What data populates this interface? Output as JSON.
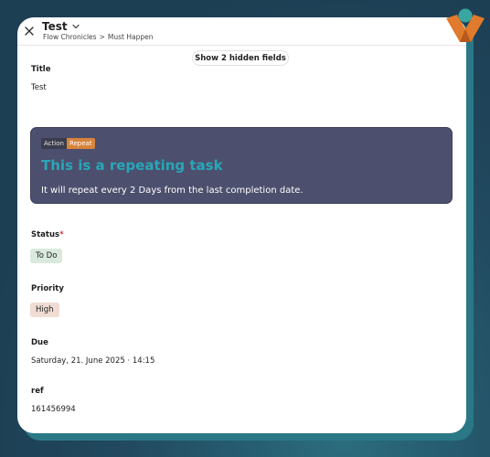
{
  "header": {
    "title": "Test",
    "breadcrumb": [
      "Flow Chronicles",
      "Must Happen"
    ],
    "breadcrumb_separator": ">"
  },
  "hidden_fields_button": "Show 2 hidden fields",
  "fields": {
    "title": {
      "label": "Title",
      "value": "Test"
    },
    "status": {
      "label": "Status",
      "required_marker": "*",
      "value": "To Do"
    },
    "priority": {
      "label": "Priority",
      "value": "High"
    },
    "due": {
      "label": "Due",
      "value": "Saturday, 21. June 2025 · 14:15"
    },
    "ref": {
      "label": "ref",
      "value": "161456994"
    }
  },
  "callout": {
    "tag_action": "Action",
    "tag_repeat": "Repeat",
    "title": "This is a repeating task",
    "text": "It will repeat every 2 Days from the last completion date."
  },
  "icons": [
    "close-icon",
    "chevron-down-icon",
    "app-logo-icon"
  ],
  "colors": {
    "callout_bg": "#4c4f6d",
    "callout_title": "#27a7b8",
    "repeat_tag": "#d7843b",
    "status_badge": "#d9eadc",
    "priority_badge": "#f0dcd3",
    "logo_orange": "#e07a2c",
    "logo_teal": "#3aa6a0"
  }
}
